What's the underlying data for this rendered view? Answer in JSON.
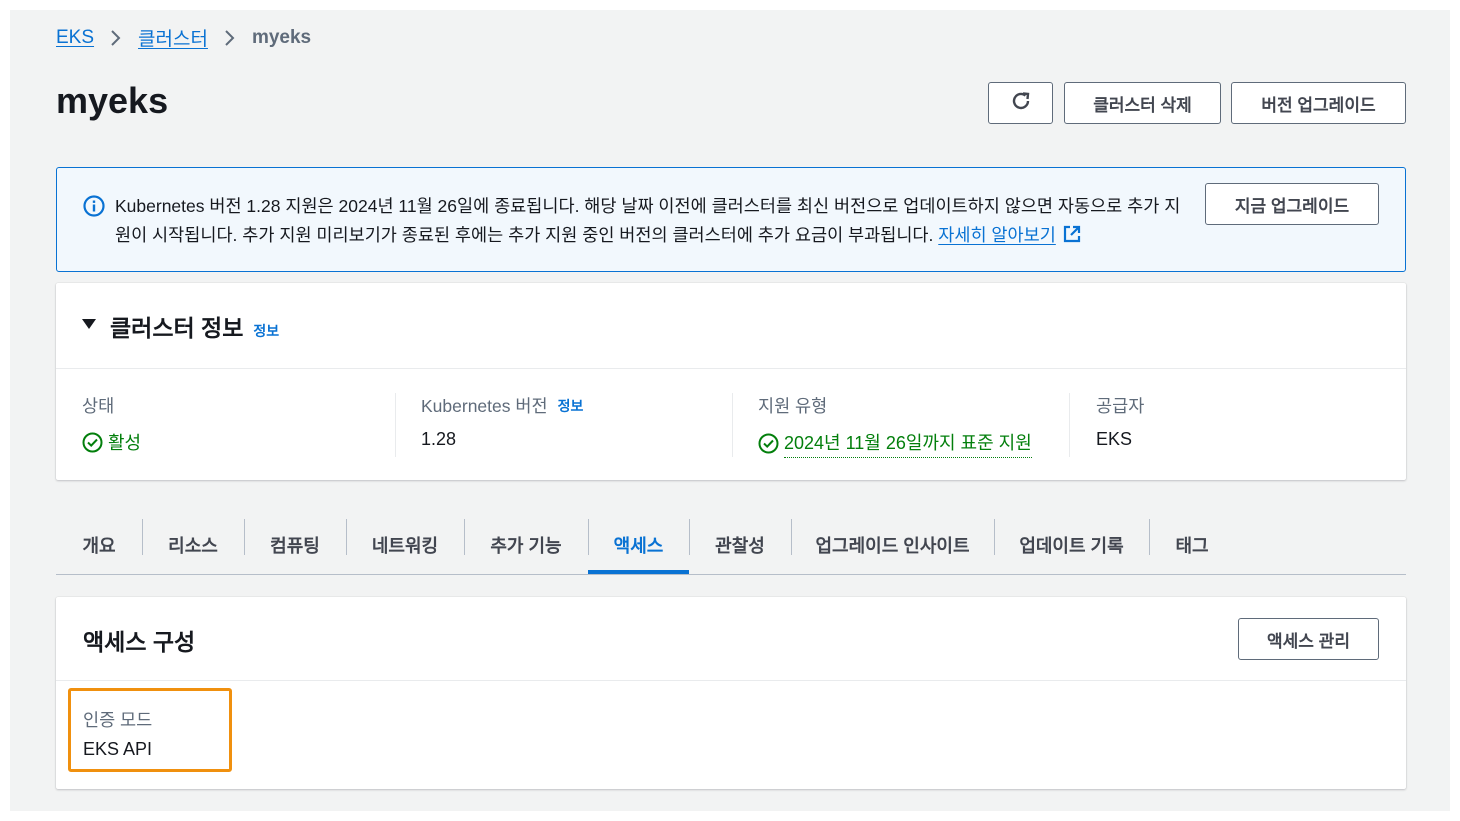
{
  "breadcrumb": {
    "root": "EKS",
    "clusters": "클러스터",
    "current": "myeks"
  },
  "page": {
    "title": "myeks"
  },
  "header_actions": {
    "delete": "클러스터 삭제",
    "upgrade": "버전 업그레이드"
  },
  "alert": {
    "text": "Kubernetes 버전 1.28 지원은 2024년 11월 26일에 종료됩니다. 해당 날짜 이전에 클러스터를 최신 버전으로 업데이트하지 않으면 자동으로 추가 지원이 시작됩니다. 추가 지원 미리보기가 종료된 후에는 추가 지원 중인 버전의 클러스터에 추가 요금이 부과됩니다.",
    "link": "자세히 알아보기",
    "button": "지금 업그레이드"
  },
  "cluster_info": {
    "title": "클러스터 정보",
    "info_link": "정보",
    "status_label": "상태",
    "status_value": "활성",
    "k8s_label": "Kubernetes 버전",
    "k8s_info": "정보",
    "k8s_value": "1.28",
    "support_label": "지원 유형",
    "support_value": "2024년 11월 26일까지 표준 지원",
    "provider_label": "공급자",
    "provider_value": "EKS"
  },
  "tabs": [
    "개요",
    "리소스",
    "컴퓨팅",
    "네트워킹",
    "추가 기능",
    "액세스",
    "관찰성",
    "업그레이드 인사이트",
    "업데이트 기록",
    "태그"
  ],
  "access": {
    "title": "액세스 구성",
    "manage_button": "액세스 관리",
    "auth_label": "인증 모드",
    "auth_value": "EKS API"
  },
  "colors": {
    "link": "#0972d3",
    "success": "#037f0c",
    "highlight": "#f0900e",
    "info_bg": "#f2f8fd"
  }
}
